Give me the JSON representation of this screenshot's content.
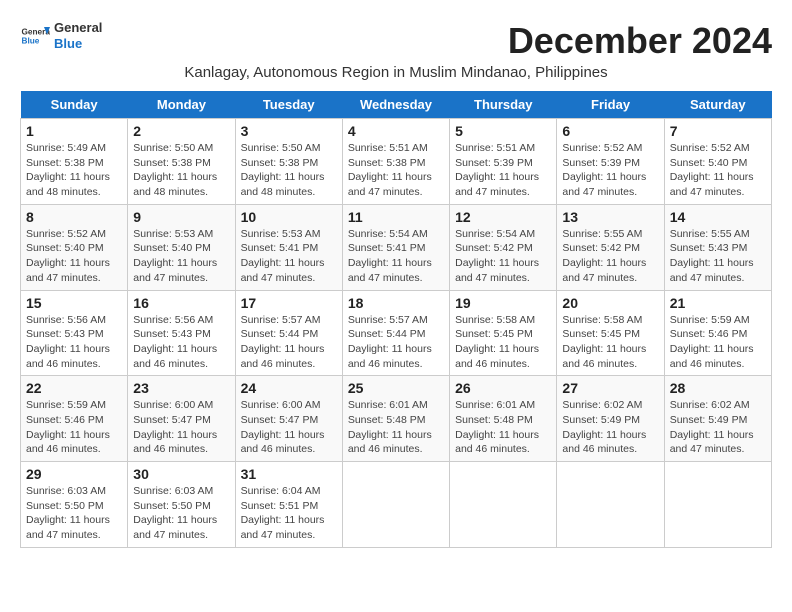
{
  "header": {
    "logo_line1": "General",
    "logo_line2": "Blue",
    "month_year": "December 2024",
    "location": "Kanlagay, Autonomous Region in Muslim Mindanao, Philippines"
  },
  "weekdays": [
    "Sunday",
    "Monday",
    "Tuesday",
    "Wednesday",
    "Thursday",
    "Friday",
    "Saturday"
  ],
  "weeks": [
    [
      {
        "day": "1",
        "sunrise": "5:49 AM",
        "sunset": "5:38 PM",
        "daylight": "11 hours and 48 minutes."
      },
      {
        "day": "2",
        "sunrise": "5:50 AM",
        "sunset": "5:38 PM",
        "daylight": "11 hours and 48 minutes."
      },
      {
        "day": "3",
        "sunrise": "5:50 AM",
        "sunset": "5:38 PM",
        "daylight": "11 hours and 48 minutes."
      },
      {
        "day": "4",
        "sunrise": "5:51 AM",
        "sunset": "5:38 PM",
        "daylight": "11 hours and 47 minutes."
      },
      {
        "day": "5",
        "sunrise": "5:51 AM",
        "sunset": "5:39 PM",
        "daylight": "11 hours and 47 minutes."
      },
      {
        "day": "6",
        "sunrise": "5:52 AM",
        "sunset": "5:39 PM",
        "daylight": "11 hours and 47 minutes."
      },
      {
        "day": "7",
        "sunrise": "5:52 AM",
        "sunset": "5:40 PM",
        "daylight": "11 hours and 47 minutes."
      }
    ],
    [
      {
        "day": "8",
        "sunrise": "5:52 AM",
        "sunset": "5:40 PM",
        "daylight": "11 hours and 47 minutes."
      },
      {
        "day": "9",
        "sunrise": "5:53 AM",
        "sunset": "5:40 PM",
        "daylight": "11 hours and 47 minutes."
      },
      {
        "day": "10",
        "sunrise": "5:53 AM",
        "sunset": "5:41 PM",
        "daylight": "11 hours and 47 minutes."
      },
      {
        "day": "11",
        "sunrise": "5:54 AM",
        "sunset": "5:41 PM",
        "daylight": "11 hours and 47 minutes."
      },
      {
        "day": "12",
        "sunrise": "5:54 AM",
        "sunset": "5:42 PM",
        "daylight": "11 hours and 47 minutes."
      },
      {
        "day": "13",
        "sunrise": "5:55 AM",
        "sunset": "5:42 PM",
        "daylight": "11 hours and 47 minutes."
      },
      {
        "day": "14",
        "sunrise": "5:55 AM",
        "sunset": "5:43 PM",
        "daylight": "11 hours and 47 minutes."
      }
    ],
    [
      {
        "day": "15",
        "sunrise": "5:56 AM",
        "sunset": "5:43 PM",
        "daylight": "11 hours and 46 minutes."
      },
      {
        "day": "16",
        "sunrise": "5:56 AM",
        "sunset": "5:43 PM",
        "daylight": "11 hours and 46 minutes."
      },
      {
        "day": "17",
        "sunrise": "5:57 AM",
        "sunset": "5:44 PM",
        "daylight": "11 hours and 46 minutes."
      },
      {
        "day": "18",
        "sunrise": "5:57 AM",
        "sunset": "5:44 PM",
        "daylight": "11 hours and 46 minutes."
      },
      {
        "day": "19",
        "sunrise": "5:58 AM",
        "sunset": "5:45 PM",
        "daylight": "11 hours and 46 minutes."
      },
      {
        "day": "20",
        "sunrise": "5:58 AM",
        "sunset": "5:45 PM",
        "daylight": "11 hours and 46 minutes."
      },
      {
        "day": "21",
        "sunrise": "5:59 AM",
        "sunset": "5:46 PM",
        "daylight": "11 hours and 46 minutes."
      }
    ],
    [
      {
        "day": "22",
        "sunrise": "5:59 AM",
        "sunset": "5:46 PM",
        "daylight": "11 hours and 46 minutes."
      },
      {
        "day": "23",
        "sunrise": "6:00 AM",
        "sunset": "5:47 PM",
        "daylight": "11 hours and 46 minutes."
      },
      {
        "day": "24",
        "sunrise": "6:00 AM",
        "sunset": "5:47 PM",
        "daylight": "11 hours and 46 minutes."
      },
      {
        "day": "25",
        "sunrise": "6:01 AM",
        "sunset": "5:48 PM",
        "daylight": "11 hours and 46 minutes."
      },
      {
        "day": "26",
        "sunrise": "6:01 AM",
        "sunset": "5:48 PM",
        "daylight": "11 hours and 46 minutes."
      },
      {
        "day": "27",
        "sunrise": "6:02 AM",
        "sunset": "5:49 PM",
        "daylight": "11 hours and 46 minutes."
      },
      {
        "day": "28",
        "sunrise": "6:02 AM",
        "sunset": "5:49 PM",
        "daylight": "11 hours and 47 minutes."
      }
    ],
    [
      {
        "day": "29",
        "sunrise": "6:03 AM",
        "sunset": "5:50 PM",
        "daylight": "11 hours and 47 minutes."
      },
      {
        "day": "30",
        "sunrise": "6:03 AM",
        "sunset": "5:50 PM",
        "daylight": "11 hours and 47 minutes."
      },
      {
        "day": "31",
        "sunrise": "6:04 AM",
        "sunset": "5:51 PM",
        "daylight": "11 hours and 47 minutes."
      },
      null,
      null,
      null,
      null
    ]
  ],
  "labels": {
    "sunrise": "Sunrise:",
    "sunset": "Sunset:",
    "daylight": "Daylight:"
  }
}
